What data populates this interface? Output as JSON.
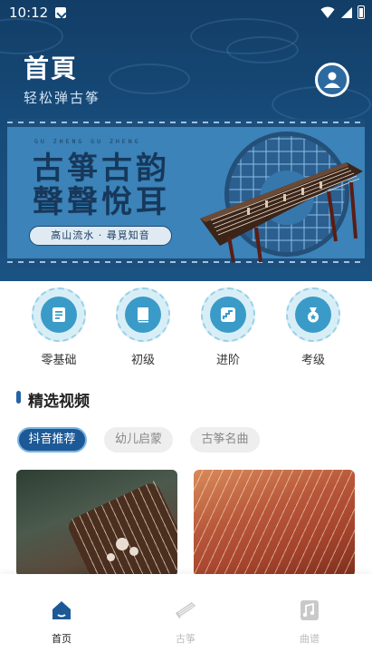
{
  "status_bar": {
    "time": "10:12"
  },
  "header": {
    "title": "首頁",
    "subtitle": "轻松弹古筝"
  },
  "banner": {
    "pinyin": "GU ZHENG GU ZHENG",
    "headline_line1": "古箏古韵",
    "headline_line2": "聲聲悅耳",
    "tagline": "高山流水 · 尋覓知音"
  },
  "categories": [
    {
      "label": "零基础",
      "icon": "book-icon"
    },
    {
      "label": "初级",
      "icon": "notebook-icon"
    },
    {
      "label": "进阶",
      "icon": "stairs-icon"
    },
    {
      "label": "考级",
      "icon": "medal-icon"
    }
  ],
  "section": {
    "title": "精选视频"
  },
  "tabs": [
    {
      "label": "抖音推荐",
      "active": true
    },
    {
      "label": "幼儿启蒙",
      "active": false
    },
    {
      "label": "古筝名曲",
      "active": false
    }
  ],
  "bottom_nav": [
    {
      "label": "首页",
      "icon": "home-icon",
      "active": true
    },
    {
      "label": "古筝",
      "icon": "guzheng-icon",
      "active": false
    },
    {
      "label": "曲谱",
      "icon": "sheet-music-icon",
      "active": false
    }
  ],
  "colors": {
    "primary": "#1d5996",
    "header_bg": "#164a78",
    "category_icon": "#3a9bc8"
  }
}
